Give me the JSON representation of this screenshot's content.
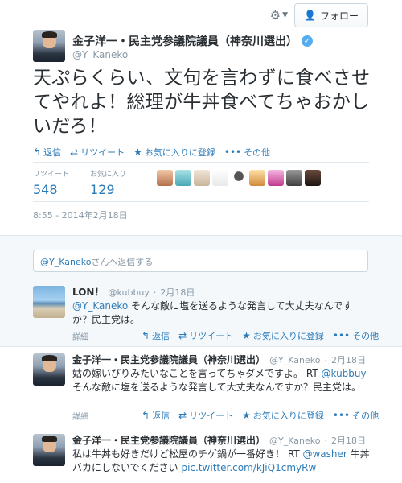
{
  "header": {
    "follow_label": "フォロー",
    "gear_icon": "gear-icon",
    "follow_icon": "person-plus-icon"
  },
  "tweet": {
    "author_name": "金子洋一・民主党参議院議員（神奈川選出）",
    "author_handle": "@Y_Kaneko",
    "text": "天ぷらくらい、文句を言わずに食べさせてやれよ！総理が牛丼食べてちゃおかしいだろ！",
    "actions": {
      "reply": "返信",
      "retweet": "リツイート",
      "favorite": "お気に入りに登録",
      "more": "その他"
    },
    "stats": {
      "retweets_label": "リツイート",
      "retweets": "548",
      "favorites_label": "お気に入り",
      "favorites": "129"
    },
    "timestamp": "8:55 - 2014年2月18日"
  },
  "reply_box": {
    "handle": "@Y_Kaneko",
    "placeholder_suffix": "さんへ返信する"
  },
  "replies": [
    {
      "name": "LON！",
      "handle": "@kubbuy",
      "time": "2月18日",
      "mention": "@Y_Kaneko",
      "text": "そんな敵に塩を送るような発言して大丈夫なんですか？民主党は。",
      "details": "詳細"
    },
    {
      "name": "金子洋一・民主党参議院議員（神奈川選出）",
      "handle": "@Y_Kaneko",
      "time": "2月18日",
      "text_a": "姑の嫁いびりみたいなことを言ってちゃダメですよ。 RT",
      "mention": "@kubbuy",
      "text_b": "そんな敵に塩を送るような発言して大丈夫なんですか？民主党は。",
      "details": "詳細"
    },
    {
      "name": "金子洋一・民主党参議院議員（神奈川選出）",
      "handle": "@Y_Kaneko",
      "time": "2月18日",
      "text_a": "私は牛丼も好きだけど松屋のチゲ鍋が一番好き！ RT",
      "mention": "@washer",
      "text_b": "牛丼バカにしないでください",
      "link": "pic.twitter.com/kJiQ1cmyRw"
    }
  ],
  "reply_actions": {
    "reply": "返信",
    "retweet": "リツイート",
    "favorite": "お気に入りに登録",
    "more": "その他"
  },
  "colors": {
    "link": "#2b7bb9",
    "muted": "#8899a6",
    "verified": "#55acee"
  }
}
